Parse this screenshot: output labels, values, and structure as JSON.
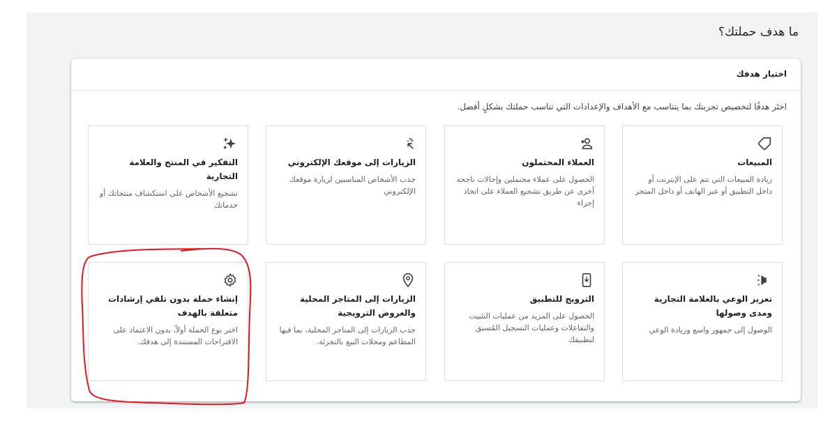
{
  "page": {
    "title": "ما هدف حملتك؟"
  },
  "panel": {
    "header": "اختيار هدفك",
    "description": "اختَر هدفًا لتخصيص تجربتك بما يتناسب مع الأهداف والإعدادات التي تناسب حملتك بشكلٍ أفضل."
  },
  "goals": [
    {
      "title": "المبيعات",
      "desc": "زيادة المبيعات التي تتم على الإنترنت أو داخل التطبيق أو عبر الهاتف أو داخل المتجر",
      "icon": "tag-icon"
    },
    {
      "title": "العملاء المحتملون",
      "desc": "الحصول على عملاء محتملين وإحالات ناجحة أخرى عن طريق تشجيع العملاء على اتخاذ إجراء",
      "icon": "people-icon"
    },
    {
      "title": "الزيارات إلى موقعك الإلكتروني",
      "desc": "جذب الأشخاص المناسبين لزيارة موقعك الإلكتروني",
      "icon": "click-icon"
    },
    {
      "title": "التفكير في المنتج والعلامة التجارية",
      "desc": "تشجيع الأشخاص على استكشاف منتجاتك أو خدماتك",
      "icon": "sparkle-icon"
    },
    {
      "title": "تعزيز الوعي بالعلامة التجارية ومدى وصولها",
      "desc": "الوصول إلى جمهور واسع وزيادة الوعي",
      "icon": "megaphone-icon"
    },
    {
      "title": "الترويج للتطبيق",
      "desc": "الحصول على المزيد من عمليات التثبيت والتفاعلات وعمليات التسجيل المُسبق لتطبيقك",
      "icon": "phone-download-icon"
    },
    {
      "title": "الزيارات إلى المتاجر المحلية والعروض الترويجية",
      "desc": "جذب الزيارات إلى المتاجر المحلية، بما فيها المطاعم ومحلات البيع بالتجزئة.",
      "icon": "location-pin-icon"
    },
    {
      "title": "إنشاء حملة بدون تلقي إرشادات متعلقة بالهدف",
      "desc": "اختر نوع الحملة أولاً، بدون الاعتماد على الاقتراحات المستندة إلى هدفك.",
      "icon": "gear-icon"
    }
  ],
  "colors": {
    "page_bg": "#f1f3f4",
    "card_border": "#dadce0",
    "annotation": "#e8141e"
  }
}
